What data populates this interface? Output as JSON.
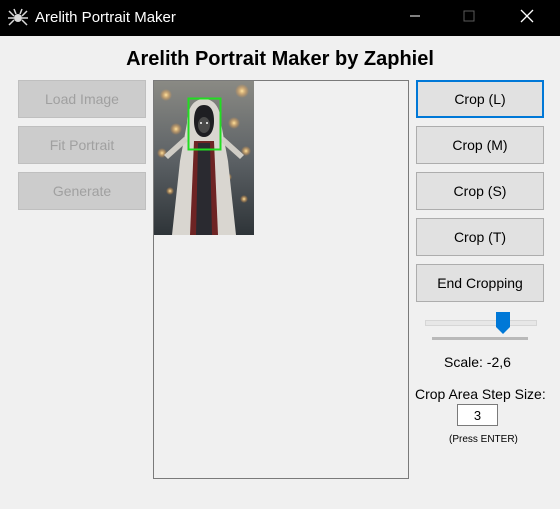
{
  "window": {
    "title": "Arelith Portrait Maker",
    "icon": "spider-emblem-icon"
  },
  "header": {
    "title": "Arelith Portrait Maker by Zaphiel"
  },
  "left_buttons": [
    {
      "label": "Load Image",
      "enabled": false
    },
    {
      "label": "Fit Portrait",
      "enabled": false
    },
    {
      "label": "Generate",
      "enabled": false
    }
  ],
  "crop_buttons": [
    {
      "label": "Crop (L)",
      "focused": true
    },
    {
      "label": "Crop (M)",
      "focused": false
    },
    {
      "label": "Crop (S)",
      "focused": false
    },
    {
      "label": "Crop (T)",
      "focused": false
    },
    {
      "label": "End Cropping",
      "focused": false
    }
  ],
  "scale": {
    "label": "Scale: -2,6",
    "slider_level": 0.72
  },
  "step_size": {
    "label": "Crop Area Step Size:",
    "value": "3",
    "hint": "(Press ENTER)"
  },
  "colors": {
    "accent": "#0078d7",
    "crop_box": "#22dd22",
    "titlebar": "#000000"
  }
}
